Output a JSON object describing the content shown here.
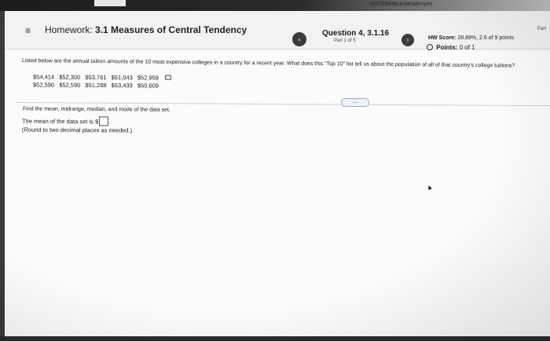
{
  "browser": {
    "url_fragment": "=65799648centerwin=yes"
  },
  "header": {
    "menu_icon": "hamburger-icon",
    "hw_prefix": "Homework:",
    "hw_title": "3.1 Measures of Central Tendency",
    "question_label": "Question 4, 3.1.16",
    "part_label": "Part 1 of 5",
    "hw_score_label": "HW Score:",
    "hw_score_value": "28.89%, 2.6 of 9 points",
    "points_label": "Points:",
    "points_value": "0 of 1",
    "right_fragment": "Part"
  },
  "problem": {
    "prompt": "Listed below are the annual tuition amounts of the 10 most expensive colleges in a country for a recent year. What does this \"Top 10\" list tell us about the population of all of that country's college tuitions?",
    "row1": [
      "$54,414",
      "$52,300",
      "$53,761",
      "$51,043",
      "$52,959"
    ],
    "row2": [
      "$52,590",
      "$52,590",
      "$51,288",
      "$53,439",
      "$50,609"
    ],
    "more_label": ".....",
    "instruction": "Find the mean, midrange, median, and mode of the data set.",
    "answer_prefix": "The mean of the data set is $",
    "round_note": "(Round to two decimal places as needed.)"
  }
}
